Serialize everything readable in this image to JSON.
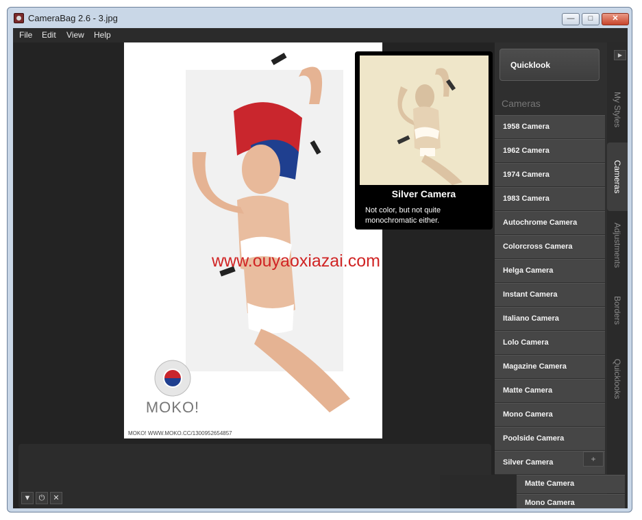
{
  "window": {
    "title": "CameraBag 2.6 - 3.jpg",
    "controls": {
      "minimize": "—",
      "maximize": "□",
      "close": "✕"
    }
  },
  "menu": [
    "File",
    "Edit",
    "View",
    "Help"
  ],
  "photo": {
    "caption": "MOKO! WWW.MOKO.CC/1300952654857",
    "logo_text": "MOKO!"
  },
  "preview": {
    "title": "Silver Camera",
    "description": "Not color, but not quite monochromatic either."
  },
  "watermark": "www.ouyaoxiazai.com",
  "sidebar": {
    "quicklook_label": "Quicklook",
    "section_title": "Cameras",
    "cameras": [
      "1958 Camera",
      "1962 Camera",
      "1974 Camera",
      "1983 Camera",
      "Autochrome Camera",
      "Colorcross Camera",
      "Helga Camera",
      "Instant Camera",
      "Italiano Camera",
      "Lolo Camera",
      "Magazine Camera",
      "Matte Camera",
      "Mono Camera",
      "Poolside Camera",
      "Silver Camera"
    ],
    "add_symbol": "+"
  },
  "tabs": [
    "My Styles",
    "Cameras",
    "Adjustments",
    "Borders",
    "Quicklooks"
  ],
  "active_tab": "Cameras",
  "collapse_symbol": "▶",
  "drag_ghost": [
    "Matte Camera",
    "Mono Camera"
  ],
  "bottom_controls": {
    "dropdown": "▼",
    "power": "⏻",
    "close": "✕"
  },
  "colors": {
    "watermark": "#d02424",
    "workspace": "#232323",
    "sidebar": "#2f2f2f"
  }
}
